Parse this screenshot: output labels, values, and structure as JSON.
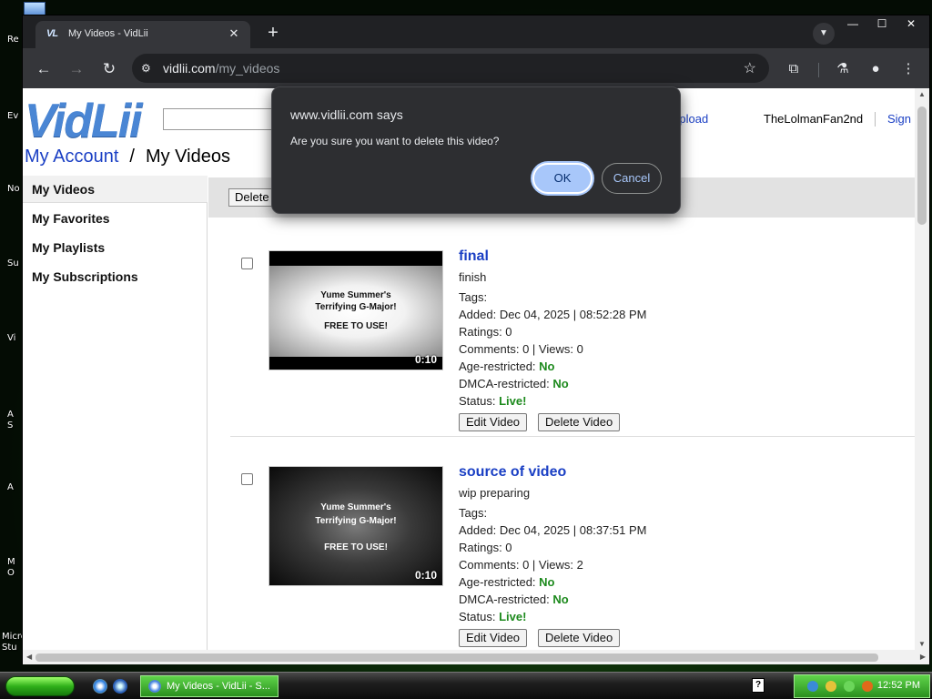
{
  "desktop": {
    "labels": [
      "Re",
      "Ev",
      "No",
      "Su",
      "Vi",
      "A S",
      "A",
      "M O",
      "Micro Stu"
    ]
  },
  "browser": {
    "tab_title": "My Videos - VidLii",
    "tab_favicon": "VL",
    "url_host": "vidlii.com",
    "url_path": "/my_videos"
  },
  "site": {
    "logo": "VidLii",
    "upload": "Upload",
    "username": "TheLolmanFan2nd",
    "signin": "Sign",
    "breadcrumb_link": "My Account",
    "breadcrumb_sep": "/",
    "breadcrumb_current": "My Videos",
    "delete_button": "Delete"
  },
  "sidebar": {
    "items": [
      {
        "label": "My Videos"
      },
      {
        "label": "My Favorites"
      },
      {
        "label": "My Playlists"
      },
      {
        "label": "My Subscriptions"
      }
    ]
  },
  "videos": [
    {
      "title": "final",
      "description": "finish",
      "tags": "Tags:",
      "added": "Added: Dec 04, 2025 | 08:52:28 PM",
      "ratings": "Ratings: 0",
      "comments_views": "Comments: 0 | Views: 0",
      "age_label": "Age-restricted:",
      "age_value": "No",
      "dmca_label": "DMCA-restricted:",
      "dmca_value": "No",
      "status_label": "Status:",
      "status_value": "Live!",
      "duration": "0:10",
      "thumb_line1": "Yume Summer's",
      "thumb_line2": "Terrifying G-Major!",
      "thumb_line3": "FREE TO USE!",
      "edit_button": "Edit Video",
      "delete_button": "Delete Video"
    },
    {
      "title": "source of video",
      "description": "wip preparing",
      "tags": "Tags:",
      "added": "Added: Dec 04, 2025 | 08:37:51 PM",
      "ratings": "Ratings: 0",
      "comments_views": "Comments: 0 | Views: 2",
      "age_label": "Age-restricted:",
      "age_value": "No",
      "dmca_label": "DMCA-restricted:",
      "dmca_value": "No",
      "status_label": "Status:",
      "status_value": "Live!",
      "duration": "0:10",
      "thumb_line1": "Yume Summer's",
      "thumb_line2": "Terrifying G-Major!",
      "thumb_line3": "FREE TO USE!",
      "edit_button": "Edit Video",
      "delete_button": "Delete Video"
    }
  ],
  "dialog": {
    "title": "www.vidlii.com says",
    "message": "Are you sure you want to delete this video?",
    "ok": "OK",
    "cancel": "Cancel"
  },
  "taskbar": {
    "task_label": "My Videos - VidLii - S...",
    "clock": "12:52 PM"
  },
  "colors": {
    "link": "#1a3fc4",
    "green_status": "#1d8a1d",
    "dialog_bg": "#2d2e31",
    "dialog_accent": "#a8c7fa"
  }
}
